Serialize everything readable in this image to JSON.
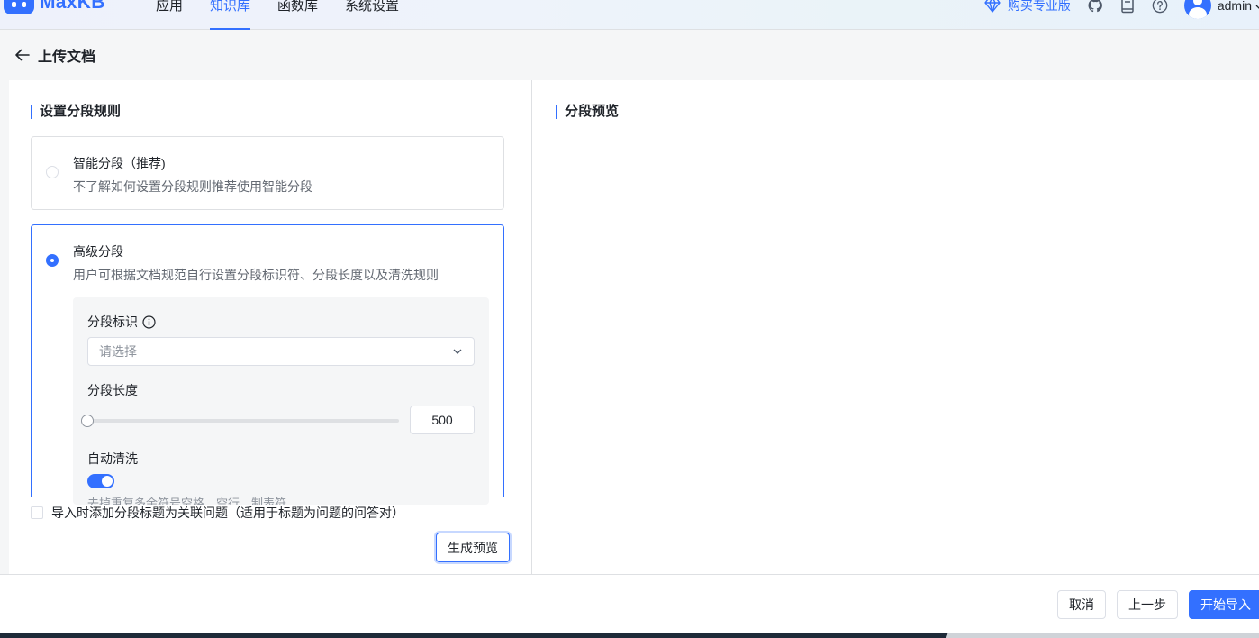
{
  "app": {
    "logo_text": "MaxKB"
  },
  "nav": {
    "items": [
      {
        "label": "应用",
        "active": false
      },
      {
        "label": "知识库",
        "active": true
      },
      {
        "label": "函数库",
        "active": false
      },
      {
        "label": "系统设置",
        "active": false
      }
    ]
  },
  "top_right": {
    "buy_label": "购买专业版",
    "icons": [
      "github-icon",
      "document-icon",
      "help-icon"
    ],
    "username": "admin"
  },
  "page": {
    "title": "上传文档"
  },
  "left_panel": {
    "section_title": "设置分段规则",
    "options": [
      {
        "title": "智能分段（推荐)",
        "desc": "不了解如何设置分段规则推荐使用智能分段",
        "selected": false
      },
      {
        "title": "高级分段",
        "desc": "用户可根据文档规范自行设置分段标识符、分段长度以及清洗规则",
        "selected": true
      }
    ],
    "segment_marker": {
      "label": "分段标识",
      "placeholder": "请选择"
    },
    "segment_length": {
      "label": "分段长度",
      "value": "500",
      "slider_fraction": 0.0
    },
    "auto_clean": {
      "label": "自动清洗",
      "enabled": true,
      "desc_partial": "去掉重复多余符号空格、空行、制表符"
    },
    "checkbox_label": "导入时添加分段标题为关联问题（适用于标题为问题的问答对）",
    "preview_button": "生成预览"
  },
  "right_panel": {
    "section_title": "分段预览"
  },
  "footer": {
    "cancel": "取消",
    "prev": "上一步",
    "start_import": "开始导入"
  },
  "colors": {
    "primary": "#3370ff",
    "text": "#1f2329",
    "muted": "#646a73"
  }
}
